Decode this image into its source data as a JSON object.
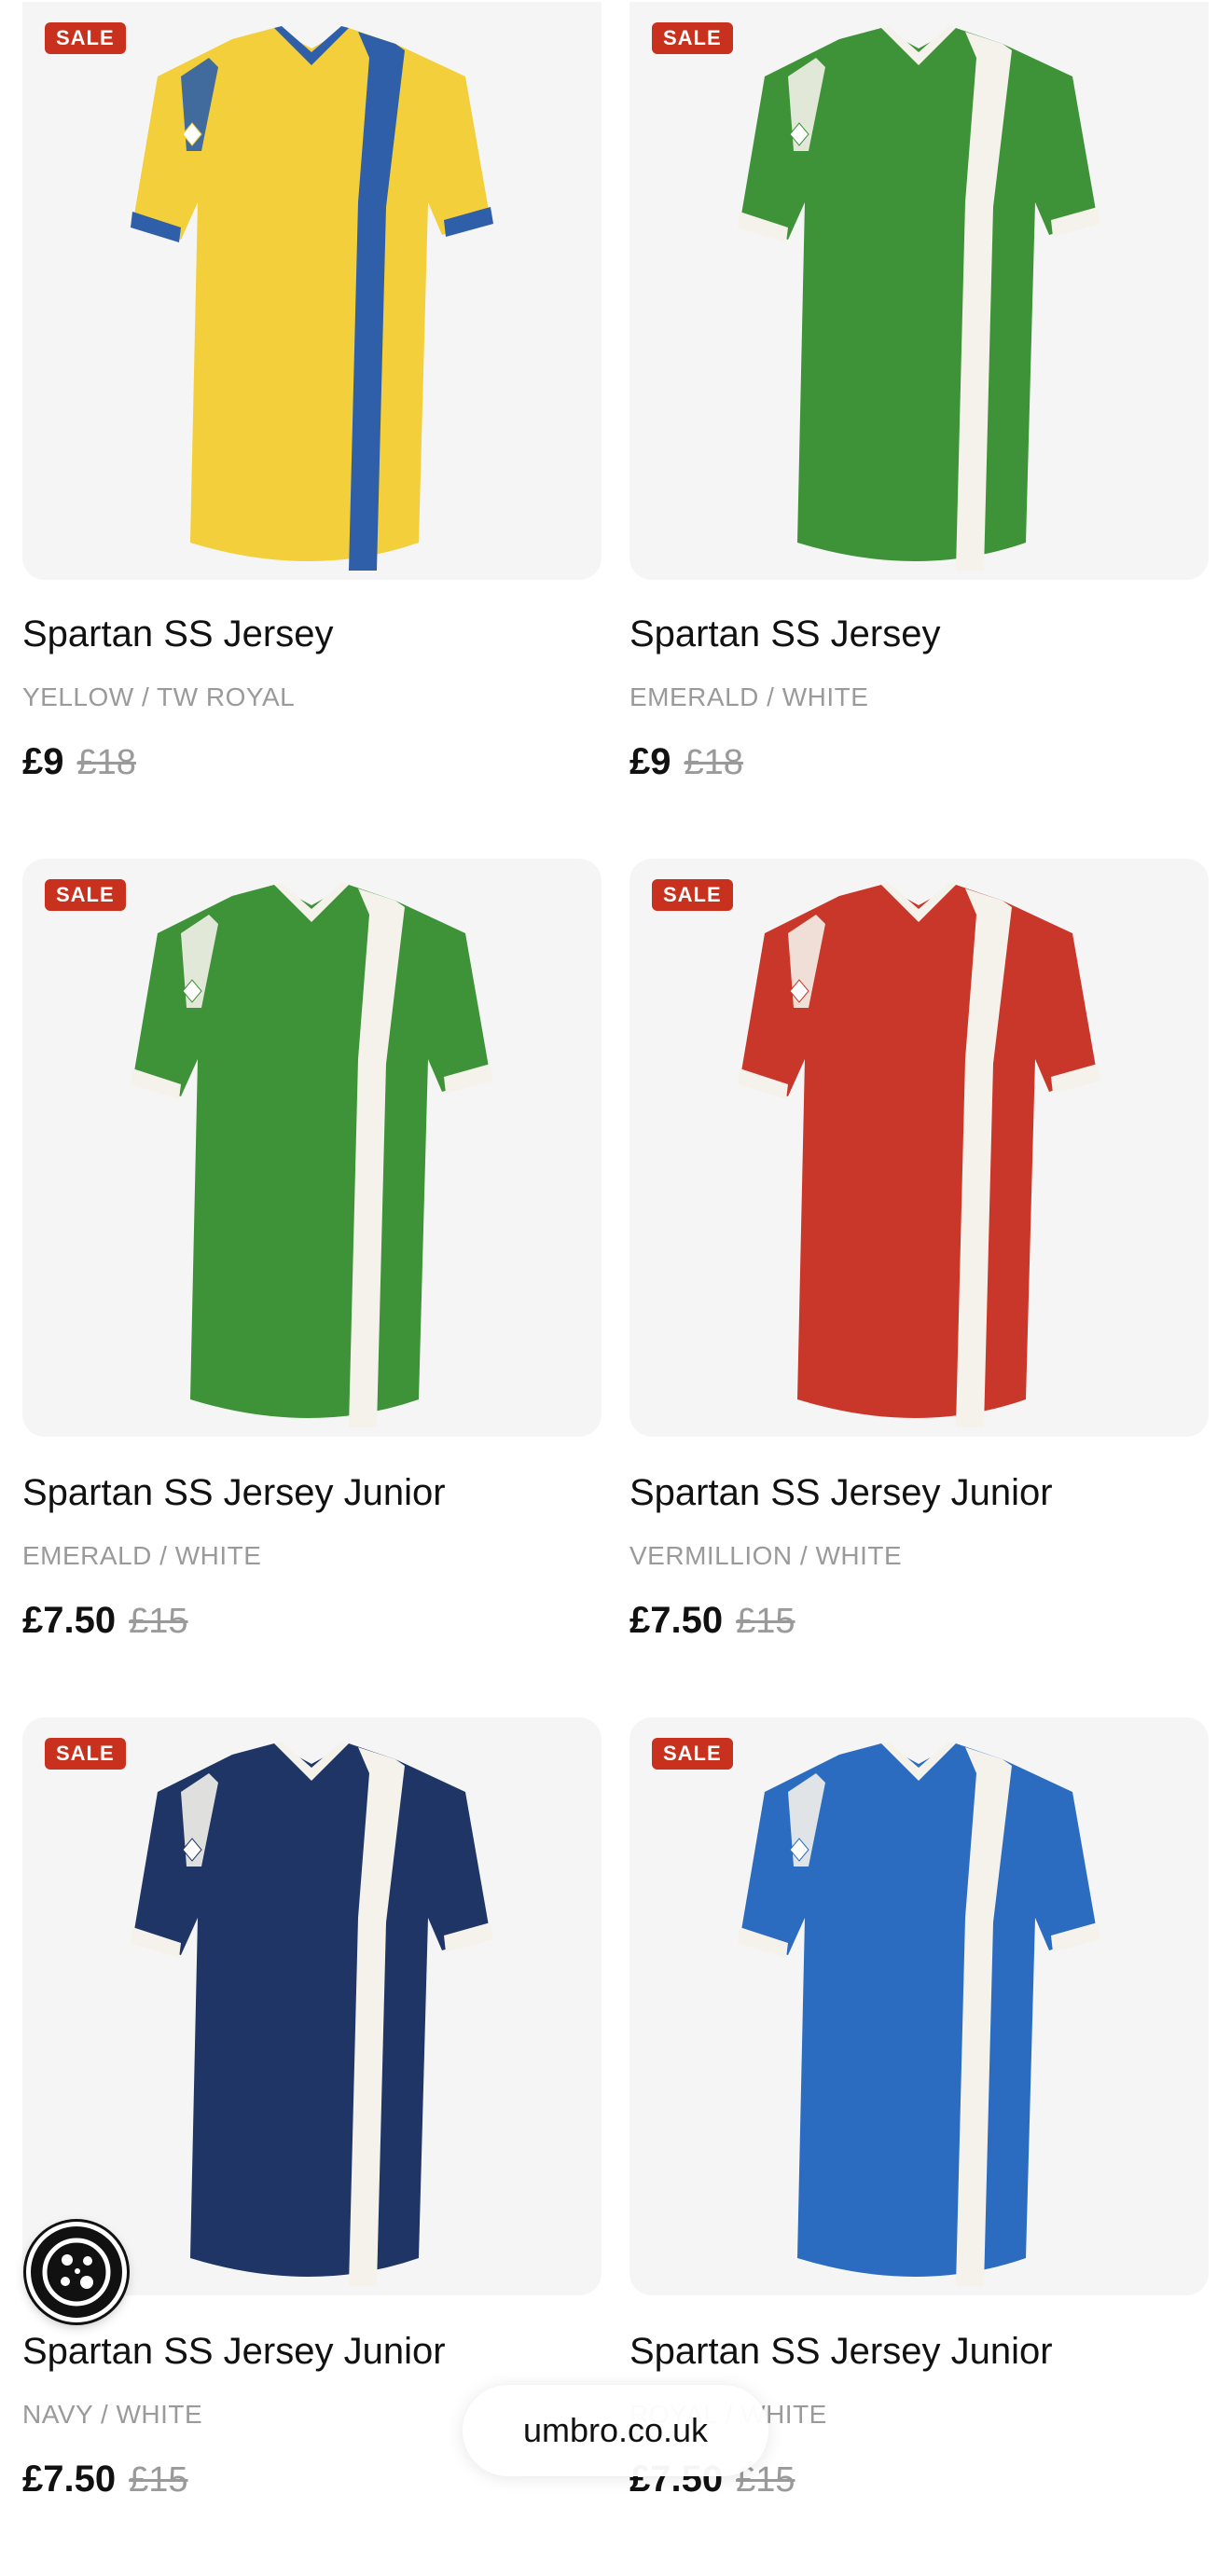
{
  "products": [
    {
      "badge": "SALE",
      "name": "Spartan SS Jersey",
      "colour": "YELLOW / TW ROYAL",
      "price": "£9",
      "was": "£18",
      "body_color": "#f2cf3b",
      "panel_color": "#2e5fa8",
      "trim_color": "#2e5fa8"
    },
    {
      "badge": "SALE",
      "name": "Spartan SS Jersey",
      "colour": "EMERALD / WHITE",
      "price": "£9",
      "was": "£18",
      "body_color": "#3e9237",
      "panel_color": "#f4f2ea",
      "trim_color": "#f4f2ea"
    },
    {
      "badge": "SALE",
      "name": "Spartan SS Jersey Junior",
      "colour": "EMERALD / WHITE",
      "price": "£7.50",
      "was": "£15",
      "body_color": "#3e9237",
      "panel_color": "#f4f2ea",
      "trim_color": "#f4f2ea"
    },
    {
      "badge": "SALE",
      "name": "Spartan SS Jersey Junior",
      "colour": "VERMILLION / WHITE",
      "price": "£7.50",
      "was": "£15",
      "body_color": "#c9362a",
      "panel_color": "#f4f2ea",
      "trim_color": "#f4f2ea"
    },
    {
      "badge": "SALE",
      "name": "Spartan SS Jersey Junior",
      "colour": "NAVY / WHITE",
      "price": "£7.50",
      "was": "£15",
      "body_color": "#1f3566",
      "panel_color": "#f4f2ea",
      "trim_color": "#f4f2ea"
    },
    {
      "badge": "SALE",
      "name": "Spartan SS Jersey Junior",
      "colour": "ROYAL / WHITE",
      "price": "£7.50",
      "was": "£15",
      "body_color": "#2b6cc0",
      "panel_color": "#f4f2ea",
      "trim_color": "#f4f2ea"
    }
  ],
  "browser": {
    "url": "umbro.co.uk"
  },
  "icons": {
    "cookie": "cookie-icon"
  }
}
